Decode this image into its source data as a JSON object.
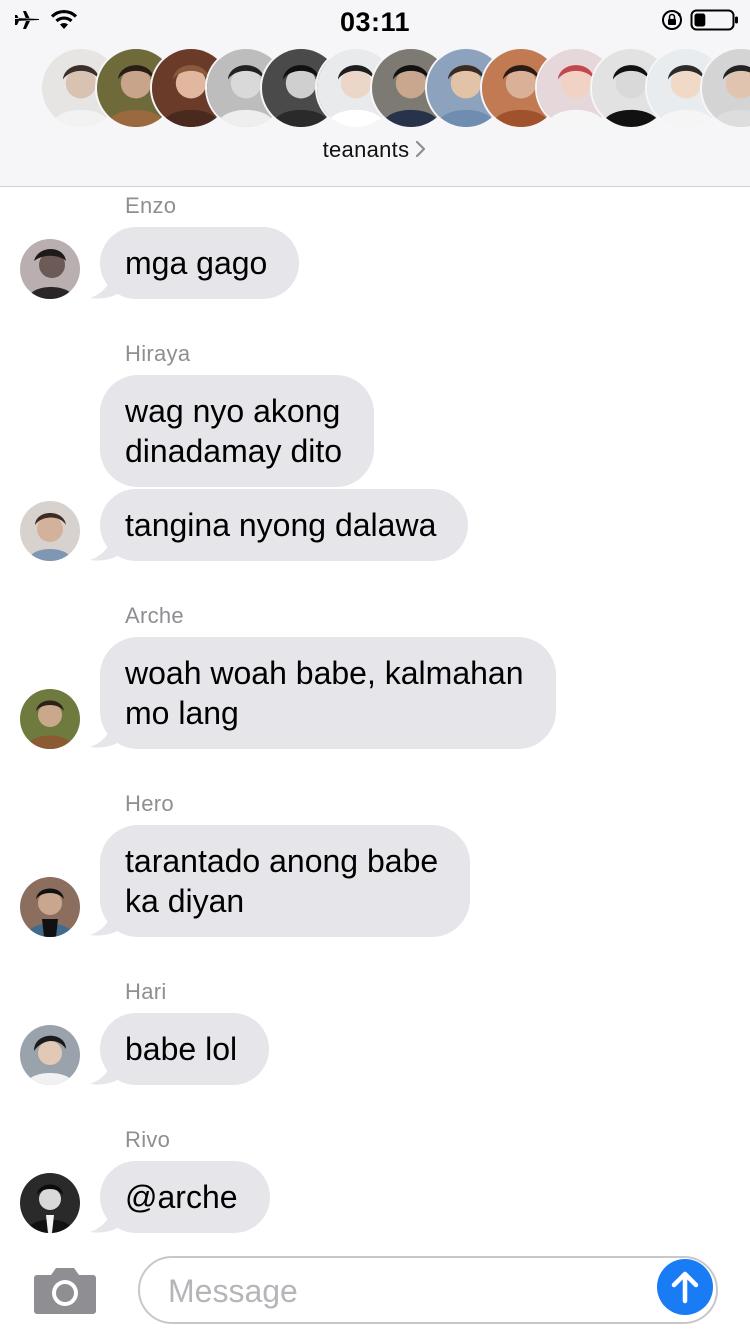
{
  "status_bar": {
    "time": "03:11",
    "icons": [
      "airplane-icon",
      "wifi-icon",
      "rotation-lock-icon",
      "battery-icon"
    ],
    "battery_level": 0.3
  },
  "group": {
    "name": "teanants",
    "member_avatar_count": 13
  },
  "input": {
    "placeholder": "Message",
    "camera_icon": "camera-icon",
    "send_icon": "arrow-up-icon"
  },
  "colors": {
    "bubble_incoming": "#e5e5ea",
    "accent_send": "#1a7cf5",
    "sender_name": "#8e8e93"
  },
  "messages": [
    {
      "sender": "Enzo",
      "bubbles": [
        {
          "lines": [
            "mga gago"
          ]
        }
      ]
    },
    {
      "sender": "Hiraya",
      "bubbles": [
        {
          "lines": [
            "wag nyo akong",
            "dinadamay dito"
          ]
        },
        {
          "lines": [
            "tangina nyong dalawa"
          ]
        }
      ]
    },
    {
      "sender": "Arche",
      "bubbles": [
        {
          "lines": [
            "woah woah babe, kalmahan",
            "mo lang"
          ]
        }
      ]
    },
    {
      "sender": "Hero",
      "bubbles": [
        {
          "lines": [
            "tarantado anong babe",
            "ka diyan"
          ]
        }
      ]
    },
    {
      "sender": "Hari",
      "bubbles": [
        {
          "lines": [
            "babe lol"
          ]
        }
      ]
    },
    {
      "sender": "Rivo",
      "bubbles": [
        {
          "lines": [
            "@arche"
          ]
        }
      ]
    }
  ]
}
